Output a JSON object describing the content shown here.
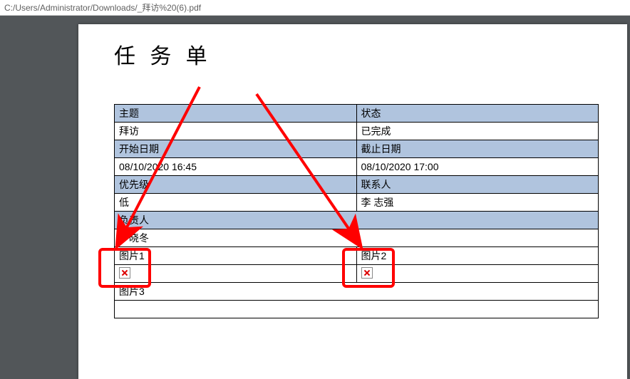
{
  "address_path": "C:/Users/Administrator/Downloads/_拜访%20(6).pdf",
  "doc": {
    "title": "任 务 单",
    "labels": {
      "subject": "主题",
      "status": "状态",
      "start_date": "开始日期",
      "due_date": "截止日期",
      "priority": "优先级",
      "contact": "联系人",
      "owner": "负责人",
      "image1": "图片1",
      "image2": "图片2",
      "image3": "图片3"
    },
    "values": {
      "subject": "拜访",
      "status": "已完成",
      "start_date": "08/10/2020 16:45",
      "due_date": "08/10/2020 17:00",
      "priority": "低",
      "contact": "李 志强",
      "owner": "罗晓冬"
    }
  },
  "annotations": {
    "red_boxes": [
      "around-image1-broken-icon",
      "around-image2-broken-icon"
    ],
    "red_arrows": [
      "arrow-to-image1-box",
      "arrow-to-image2-box"
    ]
  }
}
